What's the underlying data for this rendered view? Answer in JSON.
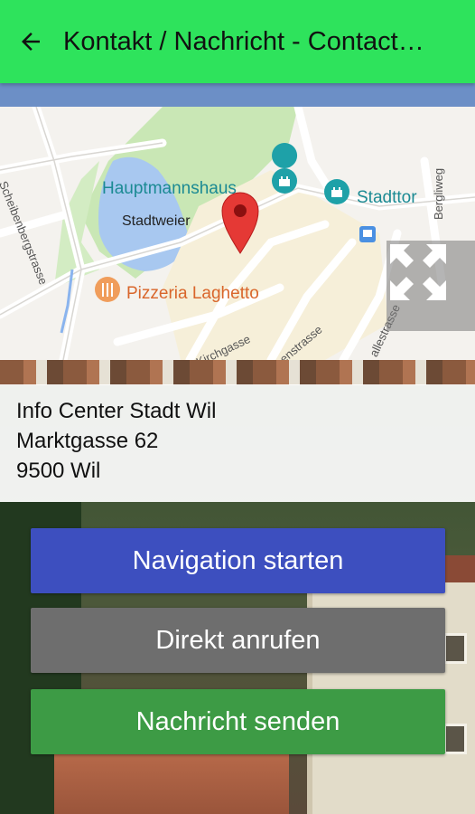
{
  "appbar": {
    "title": "Kontakt / Nachricht - Contact…",
    "back_icon": "arrow-left-icon",
    "color": "#2ee35c"
  },
  "map": {
    "labels": {
      "hauptmannshaus": "Hauptmannshaus",
      "stadttor": "Stadttor",
      "stadtweier": "Stadtweier",
      "pizzeria": "Pizzeria Laghetto",
      "scheibenbergstrasse": "Scheibenbergstrasse",
      "kirchgasse": "Kirchgasse",
      "marktgasse_frag": "enstrasse",
      "allee_frag": "allestrasse",
      "bergliweg": "Bergliweg"
    },
    "pin_icon": "map-pin-icon",
    "fullscreen_icon": "fullscreen-expand-icon"
  },
  "address": {
    "name": "Info Center Stadt Wil",
    "street": "Marktgasse 62",
    "city": "9500 Wil"
  },
  "buttons": {
    "navigation": "Navigation starten",
    "call": "Direkt anrufen",
    "message": "Nachricht senden"
  },
  "colors": {
    "nav_button": "#3d4fbf",
    "call_button": "#6e6e6e",
    "message_button": "#3d9b45"
  }
}
